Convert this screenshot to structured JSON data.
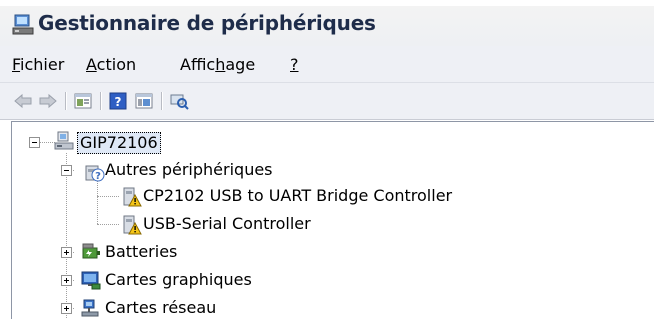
{
  "window": {
    "title": "Gestionnaire de périphériques"
  },
  "menu": {
    "items": [
      {
        "label": "Fichier"
      },
      {
        "label": "Action"
      },
      {
        "label": "Affichage"
      },
      {
        "label": "?"
      }
    ]
  },
  "toolbar": {
    "buttons": [
      {
        "icon": "back-arrow-icon"
      },
      {
        "icon": "forward-arrow-icon"
      },
      {
        "icon": "properties-icon"
      },
      {
        "icon": "help-icon"
      },
      {
        "icon": "panel-icon"
      },
      {
        "icon": "scan-hardware-icon"
      }
    ]
  },
  "tree": {
    "root": {
      "label": "GIP72106",
      "icon": "computer-icon"
    },
    "nodes": [
      {
        "label": "Autres périphériques",
        "icon": "unknown-device-icon",
        "expanded": true
      },
      {
        "label": "CP2102 USB to UART Bridge Controller",
        "icon": "warning-device-icon"
      },
      {
        "label": "USB-Serial Controller",
        "icon": "warning-device-icon"
      },
      {
        "label": "Batteries",
        "icon": "battery-icon",
        "expanded": false
      },
      {
        "label": "Cartes graphiques",
        "icon": "display-adapter-icon",
        "expanded": false
      },
      {
        "label": "Cartes réseau",
        "icon": "network-adapter-icon",
        "expanded": false
      }
    ]
  }
}
